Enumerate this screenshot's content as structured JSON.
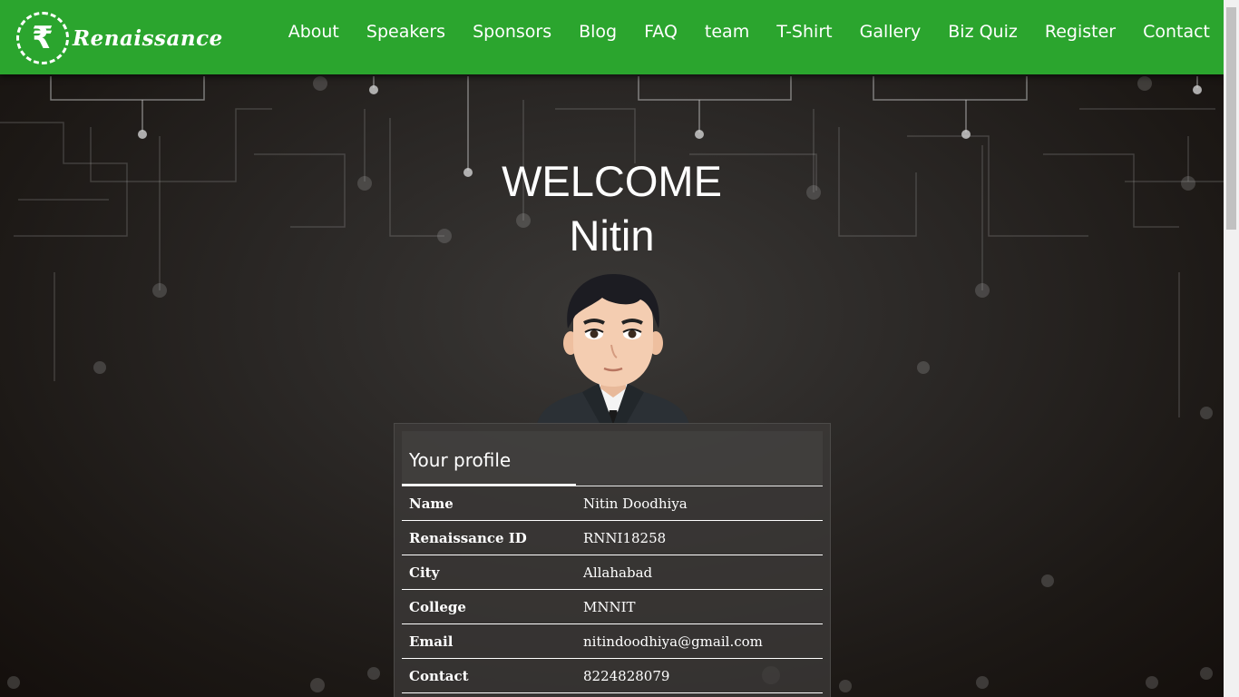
{
  "brand": {
    "logo_symbol": "₹",
    "logo_text": "Renaissance"
  },
  "nav": {
    "items": [
      "About",
      "Speakers",
      "Sponsors",
      "Blog",
      "FAQ",
      "team",
      "T-Shirt",
      "Gallery",
      "Biz Quiz",
      "Register",
      "Contact"
    ]
  },
  "welcome": {
    "line1": "WELCOME",
    "line2": "Nitin"
  },
  "profile": {
    "heading": "Your profile",
    "rows": [
      {
        "label": "Name",
        "value": "Nitin Doodhiya"
      },
      {
        "label": "Renaissance ID",
        "value": "RNNI18258"
      },
      {
        "label": "City",
        "value": "Allahabad"
      },
      {
        "label": "College",
        "value": "MNNIT"
      },
      {
        "label": "Email",
        "value": "nitindoodhiya@gmail.com"
      },
      {
        "label": "Contact",
        "value": "8224828079"
      }
    ]
  },
  "colors": {
    "navbar": "#2ba52e",
    "text": "#ffffff",
    "background": "#2a2725"
  }
}
